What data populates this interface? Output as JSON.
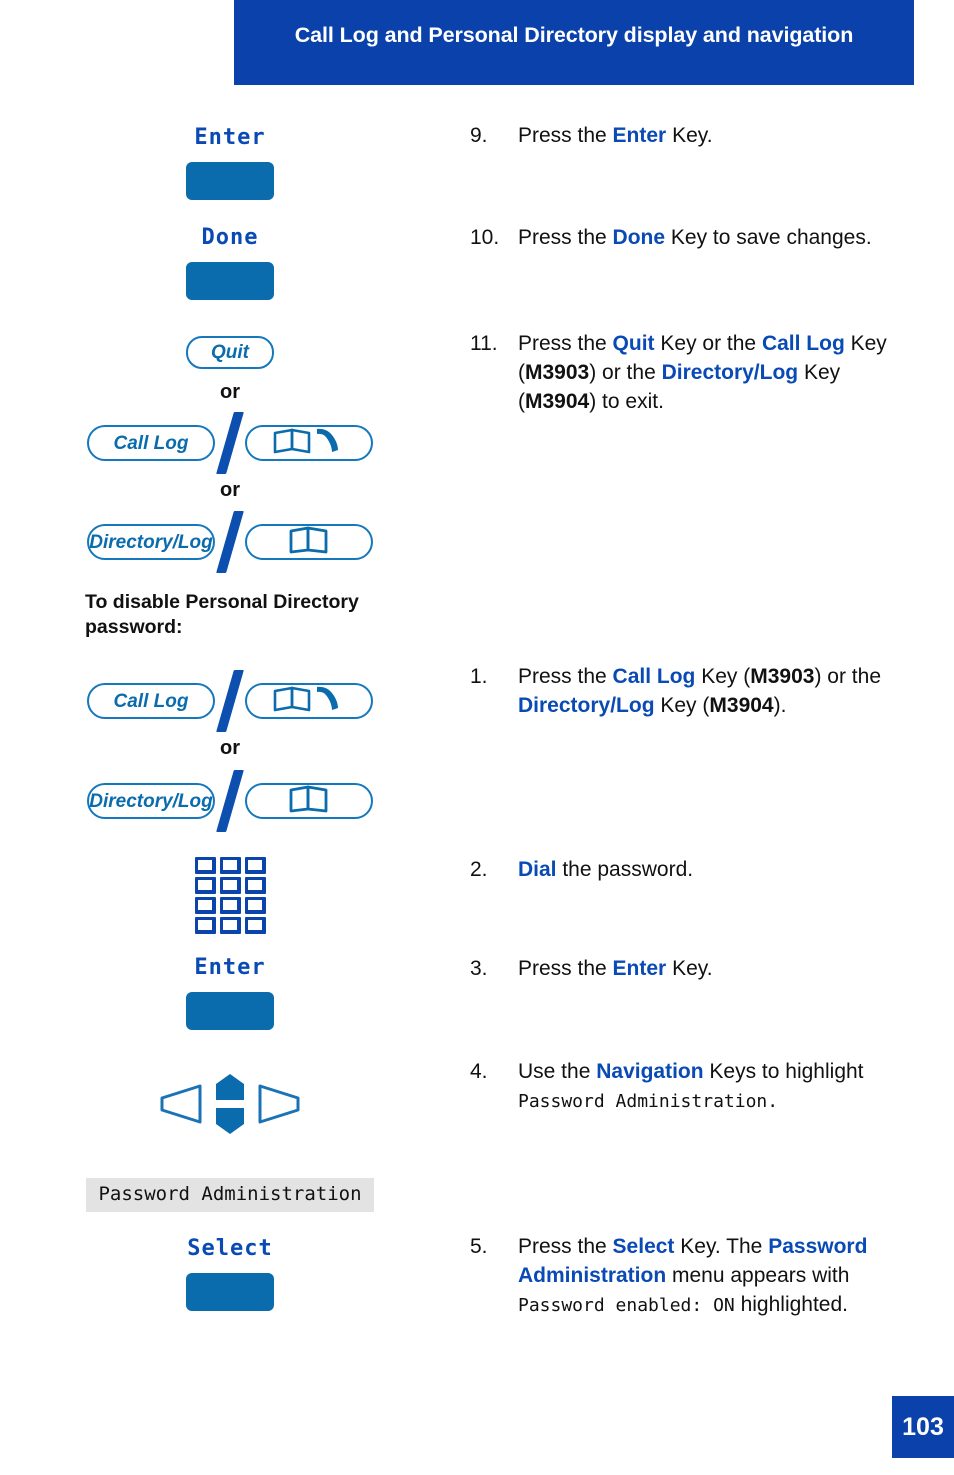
{
  "header": {
    "title": "Call Log and Personal Directory display and navigation"
  },
  "footer": {
    "page_number": "103"
  },
  "colors": {
    "header_blue": "#0a41ab",
    "softkey_blue": "#0a6cad",
    "text_blue": "#0a4ab5",
    "key_outline": "#1578bd",
    "slash_blue": "#0d4fae",
    "lcd_highlight_bg": "#e3e3e3"
  },
  "left_column": {
    "softkey_enter_top": {
      "label": "Enter"
    },
    "softkey_done": {
      "label": "Done"
    },
    "key_quit": {
      "label": "Quit"
    },
    "or_1": "or",
    "pair_calllog_1": {
      "key_label": "Call Log",
      "icon": "book-handset-icon"
    },
    "or_2": "or",
    "pair_directorylog_1": {
      "key_label": "Directory/Log",
      "icon": "open-book-icon"
    },
    "section_heading": "To disable Personal Directory\npassword:",
    "pair_calllog_2": {
      "key_label": "Call Log",
      "icon": "book-handset-icon"
    },
    "or_3": "or",
    "pair_directorylog_2": {
      "key_label": "Directory/Log",
      "icon": "open-book-icon"
    },
    "keypad_icon": "dialpad-icon",
    "softkey_enter_bottom": {
      "label": "Enter"
    },
    "navigation_cluster_icon": "navigation-keys-icon",
    "lcd_menu_highlight": "Password Administration",
    "softkey_select": {
      "label": "Select"
    }
  },
  "steps_upper": [
    {
      "number": "9.",
      "parts": [
        {
          "t": "Press the ",
          "s": "plain"
        },
        {
          "t": "Enter",
          "s": "blue"
        },
        {
          "t": " Key.",
          "s": "plain"
        }
      ]
    },
    {
      "number": "10.",
      "parts": [
        {
          "t": "Press the ",
          "s": "plain"
        },
        {
          "t": "Done",
          "s": "blue"
        },
        {
          "t": " Key to save changes.",
          "s": "plain"
        }
      ]
    },
    {
      "number": "11.",
      "parts": [
        {
          "t": "Press the ",
          "s": "plain"
        },
        {
          "t": "Quit",
          "s": "blue"
        },
        {
          "t": " Key or the ",
          "s": "plain"
        },
        {
          "t": "Call Log",
          "s": "blue"
        },
        {
          "t": " Key (",
          "s": "plain"
        },
        {
          "t": "M3903",
          "s": "black-bold"
        },
        {
          "t": ") or the ",
          "s": "plain"
        },
        {
          "t": "Directory/Log",
          "s": "blue"
        },
        {
          "t": " Key (",
          "s": "plain"
        },
        {
          "t": "M3904",
          "s": "black-bold"
        },
        {
          "t": ") to exit.",
          "s": "plain"
        }
      ]
    }
  ],
  "steps_lower": [
    {
      "number": "1.",
      "parts": [
        {
          "t": "Press the ",
          "s": "plain"
        },
        {
          "t": "Call Log",
          "s": "blue"
        },
        {
          "t": " Key (",
          "s": "plain"
        },
        {
          "t": "M3903",
          "s": "black-bold"
        },
        {
          "t": ") or the ",
          "s": "plain"
        },
        {
          "t": "Directory/Log",
          "s": "blue"
        },
        {
          "t": " Key (",
          "s": "plain"
        },
        {
          "t": "M3904",
          "s": "black-bold"
        },
        {
          "t": ").",
          "s": "plain"
        }
      ]
    },
    {
      "number": "2.",
      "parts": [
        {
          "t": "Dial",
          "s": "blue"
        },
        {
          "t": " the password.",
          "s": "plain"
        }
      ]
    },
    {
      "number": "3.",
      "parts": [
        {
          "t": "Press the ",
          "s": "plain"
        },
        {
          "t": "Enter",
          "s": "blue"
        },
        {
          "t": " Key.",
          "s": "plain"
        }
      ]
    },
    {
      "number": "4.",
      "parts": [
        {
          "t": "Use the ",
          "s": "plain"
        },
        {
          "t": "Navigation",
          "s": "blue"
        },
        {
          "t": " Keys to highlight ",
          "s": "plain"
        },
        {
          "t": "Password Administration.",
          "s": "mono"
        }
      ]
    },
    {
      "number": "5.",
      "parts": [
        {
          "t": "Press the ",
          "s": "plain"
        },
        {
          "t": "Select",
          "s": "blue"
        },
        {
          "t": " Key. The ",
          "s": "plain"
        },
        {
          "t": "Password Administration",
          "s": "blue"
        },
        {
          "t": " menu appears with ",
          "s": "plain"
        },
        {
          "t": "Password enabled: ON",
          "s": "mono"
        },
        {
          "t": " highlighted.",
          "s": "plain"
        }
      ]
    }
  ]
}
